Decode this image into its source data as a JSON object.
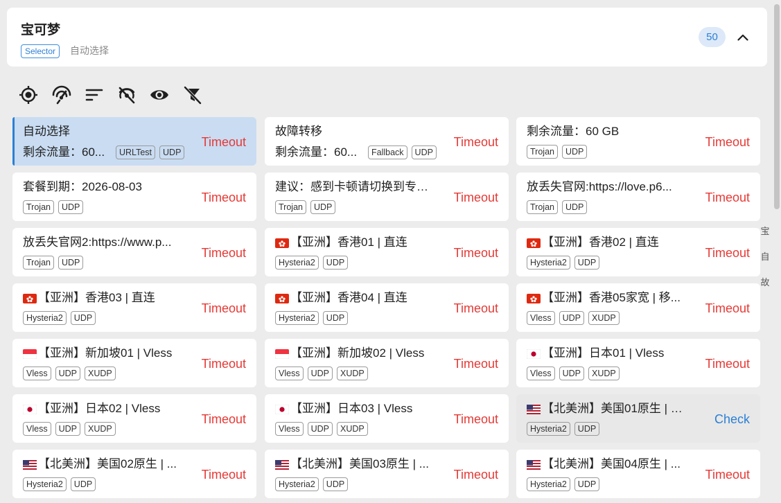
{
  "group": {
    "title": "宝可梦",
    "type": "Selector",
    "current": "自动选择",
    "count": "50"
  },
  "toolbar": {
    "icons": [
      "locate-icon",
      "delay-test-icon",
      "sort-icon",
      "url-check-off-icon",
      "show-detail-icon",
      "filter-off-icon"
    ]
  },
  "alpha_index": [
    "宝",
    "自",
    "故"
  ],
  "proxies": [
    {
      "name": "自动选择",
      "sub": "剩余流量：60...",
      "tags": [
        "URLTest",
        "UDP"
      ],
      "delay": "Timeout",
      "flag": "",
      "selected": true
    },
    {
      "name": "故障转移",
      "sub": "剩余流量：60...",
      "tags": [
        "Fallback",
        "UDP"
      ],
      "delay": "Timeout",
      "flag": ""
    },
    {
      "name": "剩余流量：60 GB",
      "tags": [
        "Trojan",
        "UDP"
      ],
      "delay": "Timeout",
      "flag": ""
    },
    {
      "name": "套餐到期：2026-08-03",
      "tags": [
        "Trojan",
        "UDP"
      ],
      "delay": "Timeout",
      "flag": ""
    },
    {
      "name": "建议：感到卡顿请切换到专线...",
      "tags": [
        "Trojan",
        "UDP"
      ],
      "delay": "Timeout",
      "flag": ""
    },
    {
      "name": "放丢失官网:https://love.p6...",
      "tags": [
        "Trojan",
        "UDP"
      ],
      "delay": "Timeout",
      "flag": ""
    },
    {
      "name": "放丢失官网2:https://www.p...",
      "tags": [
        "Trojan",
        "UDP"
      ],
      "delay": "Timeout",
      "flag": ""
    },
    {
      "name": "【亚洲】香港01 | 直连",
      "tags": [
        "Hysteria2",
        "UDP"
      ],
      "delay": "Timeout",
      "flag": "hk"
    },
    {
      "name": "【亚洲】香港02 | 直连",
      "tags": [
        "Hysteria2",
        "UDP"
      ],
      "delay": "Timeout",
      "flag": "hk"
    },
    {
      "name": "【亚洲】香港03 | 直连",
      "tags": [
        "Hysteria2",
        "UDP"
      ],
      "delay": "Timeout",
      "flag": "hk"
    },
    {
      "name": "【亚洲】香港04 | 直连",
      "tags": [
        "Hysteria2",
        "UDP"
      ],
      "delay": "Timeout",
      "flag": "hk"
    },
    {
      "name": "【亚洲】香港05家宽 | 移...",
      "tags": [
        "Vless",
        "UDP",
        "XUDP"
      ],
      "delay": "Timeout",
      "flag": "hk"
    },
    {
      "name": "【亚洲】新加坡01 | Vless",
      "tags": [
        "Vless",
        "UDP",
        "XUDP"
      ],
      "delay": "Timeout",
      "flag": "sg"
    },
    {
      "name": "【亚洲】新加坡02 | Vless",
      "tags": [
        "Vless",
        "UDP",
        "XUDP"
      ],
      "delay": "Timeout",
      "flag": "sg"
    },
    {
      "name": "【亚洲】日本01 | Vless",
      "tags": [
        "Vless",
        "UDP",
        "XUDP"
      ],
      "delay": "Timeout",
      "flag": "jp"
    },
    {
      "name": "【亚洲】日本02 | Vless",
      "tags": [
        "Vless",
        "UDP",
        "XUDP"
      ],
      "delay": "Timeout",
      "flag": "jp"
    },
    {
      "name": "【亚洲】日本03 | Vless",
      "tags": [
        "Vless",
        "UDP",
        "XUDP"
      ],
      "delay": "Timeout",
      "flag": "jp"
    },
    {
      "name": "【北美洲】美国01原生 | 直...",
      "tags": [
        "Hysteria2",
        "UDP"
      ],
      "delay": "Check",
      "flag": "us",
      "hovered": true
    },
    {
      "name": "【北美洲】美国02原生 | ...",
      "tags": [
        "Hysteria2",
        "UDP"
      ],
      "delay": "Timeout",
      "flag": "us"
    },
    {
      "name": "【北美洲】美国03原生 | ...",
      "tags": [
        "Hysteria2",
        "UDP"
      ],
      "delay": "Timeout",
      "flag": "us"
    },
    {
      "name": "【北美洲】美国04原生 | ...",
      "tags": [
        "Hysteria2",
        "UDP"
      ],
      "delay": "Timeout",
      "flag": "us"
    }
  ],
  "colors": {
    "accent": "#2b7fd6",
    "timeout": "#e53935",
    "selected_bg": "#c9dcf2",
    "page_bg": "#ececec"
  }
}
